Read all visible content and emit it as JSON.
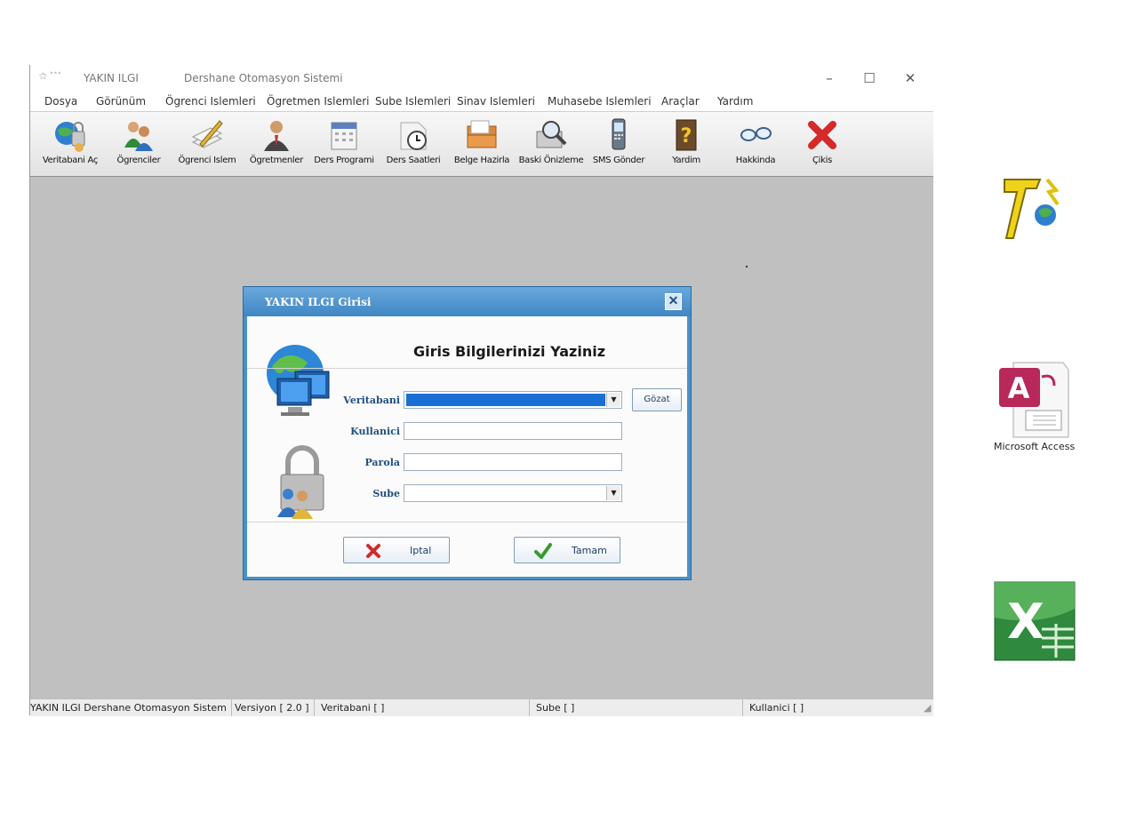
{
  "window": {
    "app_name": "YAKIN ILGI",
    "subtitle": "Dershane Otomasyon Sistemi",
    "min_glyph": "–",
    "max_glyph": "☐",
    "close_glyph": "✕"
  },
  "menu": [
    "Dosya",
    "Görünüm",
    "Ögrenci Islemleri",
    "Ögretmen Islemleri",
    "Sube Islemleri",
    "Sinav Islemleri",
    "Muhasebe Islemleri",
    "Araçlar",
    "Yardım"
  ],
  "toolbar": [
    {
      "label": "Veritabani Aç",
      "icon": "database-open-icon"
    },
    {
      "label": "Ögrenciler",
      "icon": "students-icon"
    },
    {
      "label": "Ögrenci Islem",
      "icon": "student-edit-icon"
    },
    {
      "label": "Ögretmenler",
      "icon": "teacher-icon"
    },
    {
      "label": "Ders Programi",
      "icon": "calendar-icon"
    },
    {
      "label": "Ders Saatleri",
      "icon": "clock-icon"
    },
    {
      "label": "Belge Hazirla",
      "icon": "documents-icon"
    },
    {
      "label": "Baski Önizleme",
      "icon": "print-preview-icon"
    },
    {
      "label": "SMS Gönder",
      "icon": "phone-icon"
    },
    {
      "label": "Yardim",
      "icon": "help-book-icon"
    },
    {
      "label": "Hakkinda",
      "icon": "glasses-icon"
    },
    {
      "label": "Çikis",
      "icon": "exit-x-icon"
    }
  ],
  "dialog": {
    "title": "YAKIN ILGI  Girisi",
    "close_glyph": "✕",
    "heading": "Giris Bilgilerinizi Yaziniz",
    "fields": {
      "database_label": "Veritabani",
      "database_value": "",
      "user_label": "Kullanici",
      "user_value": "",
      "password_label": "Parola",
      "password_value": "",
      "branch_label": "Sube",
      "branch_value": ""
    },
    "browse_label": "Gözat",
    "cancel_label": "Iptal",
    "ok_label": "Tamam"
  },
  "status": {
    "app": "YAKIN ILGI   Dershane Otomasyon Sistem",
    "version": "Versiyon [ 2.0 ]",
    "database": "Veritabani  [  ]",
    "branch": "Sube  [  ]",
    "user": "Kullanici  [  ]"
  },
  "desktop": {
    "access_label": "Microsoft Access"
  },
  "colors": {
    "window_bg": "#c0c0c0",
    "dialog_border": "#4a90c8",
    "label_blue": "#1f4f82",
    "selection_blue": "#1a6fd6"
  }
}
